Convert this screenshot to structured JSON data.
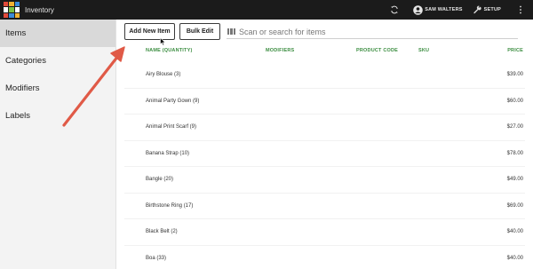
{
  "app": {
    "title": "Inventory",
    "logo_colors": [
      "#e24b3b",
      "#f2b233",
      "#3c8bd9",
      "#ffffff",
      "#7ac143",
      "#ffffff",
      "#e24b3b",
      "#3c8bd9",
      "#f2b233"
    ]
  },
  "topbar": {
    "user_label": "SAM WALTERS",
    "setup_label": "SETUP",
    "icons": [
      "sync-icon",
      "user-icon",
      "wrench-icon",
      "more-vertical-icon"
    ]
  },
  "sidebar": {
    "items": [
      {
        "label": "Items",
        "active": true
      },
      {
        "label": "Categories",
        "active": false
      },
      {
        "label": "Modifiers",
        "active": false
      },
      {
        "label": "Labels",
        "active": false
      }
    ]
  },
  "toolbar": {
    "add_label": "Add New Item",
    "bulk_label": "Bulk Edit"
  },
  "search": {
    "placeholder": "Scan or search for items",
    "value": ""
  },
  "table": {
    "columns": {
      "name": "NAME (QUANTITY)",
      "modifiers": "MODIFIERS",
      "product_code": "PRODUCT CODE",
      "sku": "SKU",
      "price": "PRICE"
    },
    "rows": [
      {
        "name": "Airy Blouse (3)",
        "price": "$39.00"
      },
      {
        "name": "Animal Party Gown (9)",
        "price": "$60.00"
      },
      {
        "name": "Animal Print Scarf (9)",
        "price": "$27.00"
      },
      {
        "name": "Banana Strap (10)",
        "price": "$78.00"
      },
      {
        "name": "Bangle (20)",
        "price": "$49.00"
      },
      {
        "name": "Birthstone Ring (17)",
        "price": "$69.00"
      },
      {
        "name": "Black Belt (2)",
        "price": "$40.00"
      },
      {
        "name": "Boa (33)",
        "price": "$40.00"
      }
    ]
  },
  "colors": {
    "topbar": "#1b1b1b",
    "header_green": "#3b8d40",
    "annotation_arrow": "#e05a47"
  }
}
